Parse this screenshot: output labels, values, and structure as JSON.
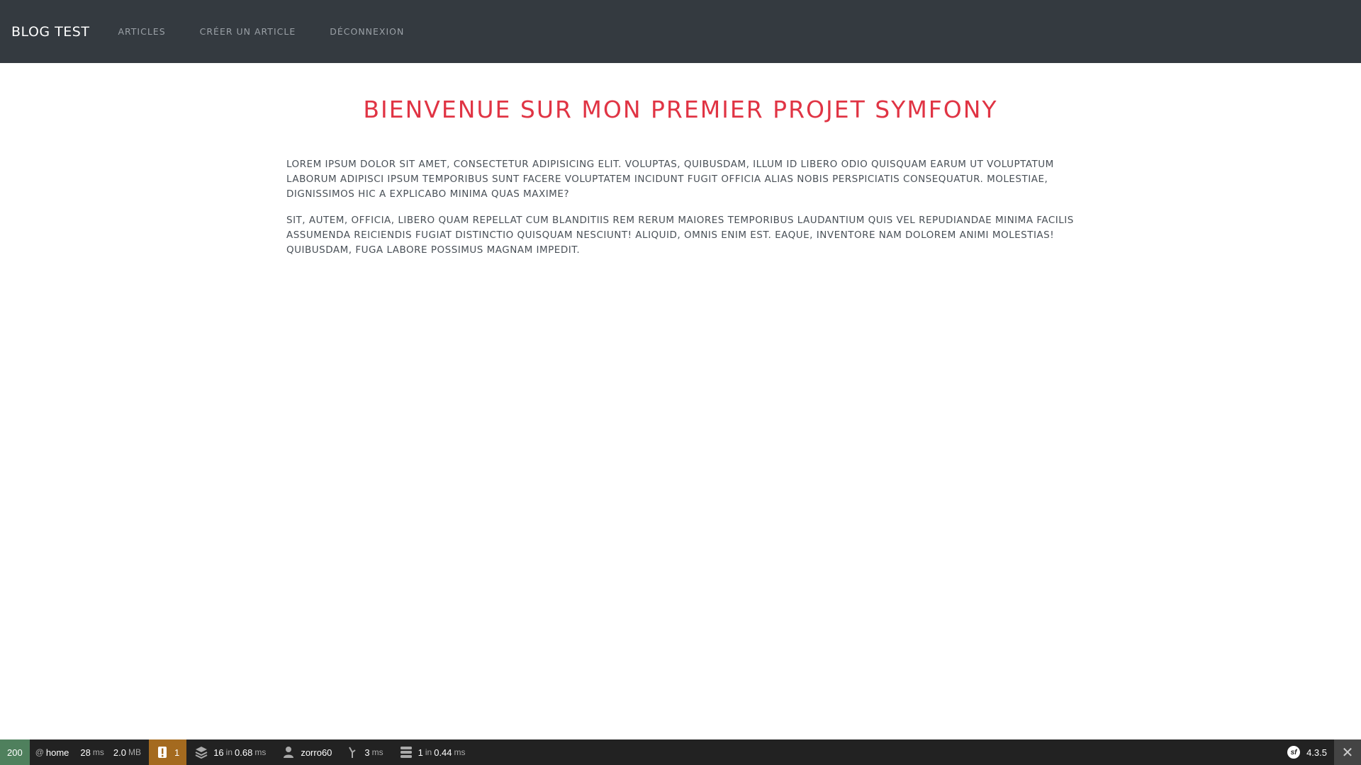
{
  "navbar": {
    "brand": "BLOG TEST",
    "links": [
      {
        "label": "ARTICLES"
      },
      {
        "label": "CRÉER UN ARTICLE"
      },
      {
        "label": "DÉCONNEXION"
      }
    ]
  },
  "main": {
    "title": "BIENVENUE SUR MON PREMIER PROJET SYMFONY",
    "paragraphs": [
      "LOREM IPSUM DOLOR SIT AMET, CONSECTETUR ADIPISICING ELIT. VOLUPTAS, QUIBUSDAM, ILLUM ID LIBERO ODIO QUISQUAM EARUM UT VOLUPTATUM LABORUM ADIPISCI IPSUM TEMPORIBUS SUNT FACERE VOLUPTATEM INCIDUNT FUGIT OFFICIA ALIAS NOBIS PERSPICIATIS CONSEQUATUR. MOLESTIAE, DIGNISSIMOS HIC A EXPLICABO MINIMA QUAS MAXIME?",
      "SIT, AUTEM, OFFICIA, LIBERO QUAM REPELLAT CUM BLANDITIIS REM RERUM MAIORES TEMPORIBUS LAUDANTIUM QUIS VEL REPUDIANDAE MINIMA FACILIS ASSUMENDA REICIENDIS FUGIAT DISTINCTIO QUISQUAM NESCIUNT! ALIQUID, OMNIS ENIM EST. EAQUE, INVENTORE NAM DOLOREM ANIMI MOLESTIAS! QUIBUSDAM, FUGA LABORE POSSIMUS MAGNAM IMPEDIT."
    ]
  },
  "toolbar": {
    "status_code": "200",
    "route_prefix": "@",
    "route": "home",
    "time_value": "28",
    "time_unit": "ms",
    "memory_value": "2.0",
    "memory_unit": "MB",
    "warning_count": "1",
    "twig_count": "16",
    "twig_in": "in",
    "twig_time": "0.68",
    "twig_unit": "ms",
    "user": "zorro60",
    "ajax_value": "3",
    "ajax_unit": "ms",
    "db_count": "1",
    "db_in": "in",
    "db_time": "0.44",
    "db_unit": "ms",
    "symfony_version": "4.3.5",
    "close_symbol": "✕",
    "icons": [
      "warning-icon",
      "layers-icon",
      "user-icon",
      "ajax-icon",
      "database-icon",
      "symfony-logo",
      "close-icon"
    ],
    "colors": {
      "background": "#222222",
      "status_ok": "#4f805d",
      "warning": "#a46a1f"
    }
  },
  "colors": {
    "navbar_bg": "#343a40",
    "title": "#e03444",
    "body_text": "#495057"
  }
}
